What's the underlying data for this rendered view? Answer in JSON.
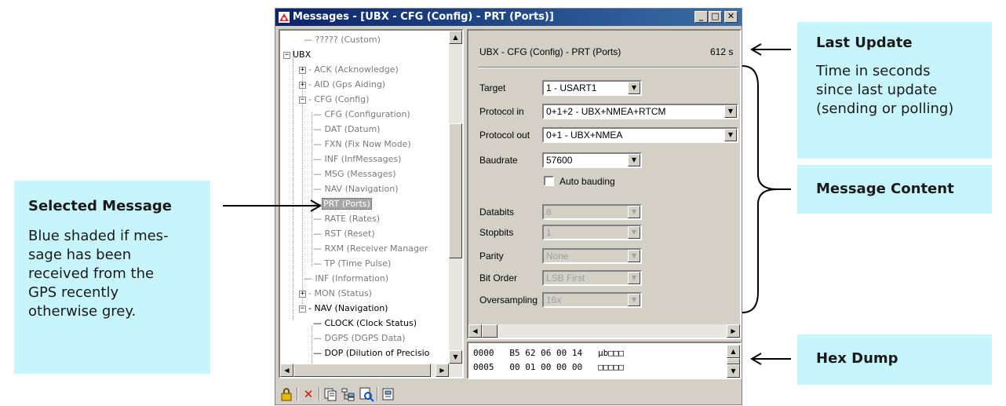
{
  "window": {
    "title": "Messages - [UBX - CFG (Config) - PRT (Ports)]",
    "min": "_",
    "max": "□",
    "close": "✕"
  },
  "tree": {
    "items": [
      {
        "label": "????? (Custom)"
      },
      {
        "label": "UBX",
        "expander": "−"
      },
      {
        "label": "ACK (Acknowledge)",
        "expander": "+"
      },
      {
        "label": "AID (Gps Aiding)",
        "expander": "+"
      },
      {
        "label": "CFG (Config)",
        "expander": "−"
      },
      {
        "label": "CFG (Configuration)"
      },
      {
        "label": "DAT (Datum)"
      },
      {
        "label": "FXN (Fix Now Mode)"
      },
      {
        "label": "INF (InfMessages)"
      },
      {
        "label": "MSG (Messages)"
      },
      {
        "label": "NAV (Navigation)"
      },
      {
        "label": "PRT (Ports)"
      },
      {
        "label": "RATE (Rates)"
      },
      {
        "label": "RST (Reset)"
      },
      {
        "label": "RXM (Receiver Manager"
      },
      {
        "label": "TP (Time Pulse)"
      },
      {
        "label": "INF (Information)"
      },
      {
        "label": "MON (Status)",
        "expander": "+"
      },
      {
        "label": "NAV (Navigation)",
        "expander": "−"
      },
      {
        "label": "CLOCK (Clock Status)"
      },
      {
        "label": "DGPS (DGPS Data)"
      },
      {
        "label": "DOP (Dilution of Precisio"
      }
    ]
  },
  "content": {
    "header": "UBX - CFG (Config) - PRT (Ports)",
    "last_update": "612 s",
    "fields": [
      {
        "label": "Target",
        "value": "1 - USART1"
      },
      {
        "label": "Protocol in",
        "value": "0+1+2 - UBX+NMEA+RTCM"
      },
      {
        "label": "Protocol out",
        "value": "0+1 - UBX+NMEA"
      },
      {
        "label": "Baudrate",
        "value": "57600"
      },
      {
        "label": "Databits",
        "value": "8"
      },
      {
        "label": "Stopbits",
        "value": "1"
      },
      {
        "label": "Parity",
        "value": "None"
      },
      {
        "label": "Bit Order",
        "value": "LSB First"
      },
      {
        "label": "Oversampling",
        "value": "16x"
      }
    ],
    "auto_bauding": "Auto bauding"
  },
  "hexdump": {
    "rows": [
      "0000   B5 62 06 00 14   µb□□□",
      "0005   00 01 00 00 00   □□□□□"
    ]
  },
  "callouts": {
    "last_update": {
      "title": "Last Update",
      "lines": [
        "Time in seconds",
        "since last update",
        "(sending or polling)"
      ]
    },
    "message_content": {
      "title": "Message Content"
    },
    "hex_dump": {
      "title": "Hex Dump"
    },
    "selected_message": {
      "title": "Selected Message",
      "lines": [
        "Blue shaded if mes-",
        "sage has been",
        "received from the",
        "GPS recently",
        "otherwise grey."
      ]
    }
  },
  "toolbar": {
    "icons": [
      "lock-icon",
      "delete-icon",
      "copy-icon",
      "tree-icon",
      "find-icon",
      "export-icon"
    ]
  },
  "colors": {
    "callout_bg": "#c7f5fb",
    "titlebar": "#0a246a",
    "window_bg": "#d4d0c8"
  }
}
